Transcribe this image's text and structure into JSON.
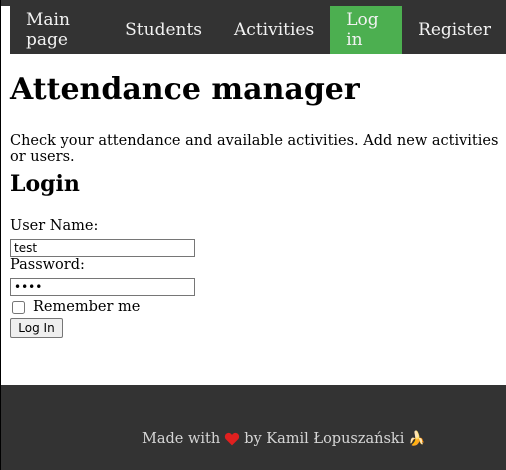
{
  "nav": {
    "items": [
      {
        "label": "Main page",
        "active": false
      },
      {
        "label": "Students",
        "active": false
      },
      {
        "label": "Activities",
        "active": false
      },
      {
        "label": "Log in",
        "active": true
      },
      {
        "label": "Register",
        "active": false
      }
    ]
  },
  "page": {
    "title": "Attendance manager",
    "intro": "Check your attendance and available activities. Add new activities or users."
  },
  "login": {
    "heading": "Login",
    "username_label": "User Name:",
    "username_value": "test",
    "password_label": "Password:",
    "password_value": "test",
    "remember_label": "Remember me",
    "remember_checked": false,
    "submit_label": "Log In"
  },
  "footer": {
    "made_with": "Made with",
    "by": "by Kamil Łopuszański",
    "heart_icon": "heart-icon",
    "banana_icon": "banana-icon",
    "heart_color": "#e0201f"
  },
  "colors": {
    "nav_bg": "#333333",
    "active_bg": "#4CAF50",
    "footer_bg": "#333333"
  }
}
